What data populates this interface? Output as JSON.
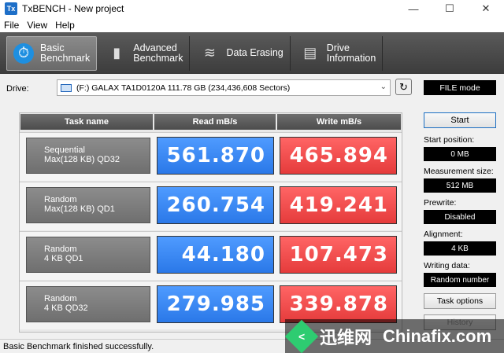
{
  "window": {
    "title": "TxBENCH - New project",
    "minimize": "—",
    "maximize": "☐",
    "close": "✕"
  },
  "menu": {
    "file": "File",
    "view": "View",
    "help": "Help"
  },
  "toolbar": {
    "basic": "Basic\nBenchmark",
    "advanced": "Advanced\nBenchmark",
    "erasing": "Data Erasing",
    "info": "Drive\nInformation"
  },
  "drive": {
    "label": "Drive:",
    "value": "(F:) GALAX TA1D0120A  111.78 GB (234,436,608 Sectors)",
    "mode": "FILE mode"
  },
  "table": {
    "headers": [
      "Task name",
      "Read mB/s",
      "Write mB/s"
    ],
    "rows": [
      {
        "task": "Sequential\nMax(128 KB) QD32",
        "read": "561.870",
        "write": "465.894"
      },
      {
        "task": "Random\nMax(128 KB) QD1",
        "read": "260.754",
        "write": "419.241"
      },
      {
        "task": "Random\n4 KB QD1",
        "read": "44.180",
        "write": "107.473"
      },
      {
        "task": "Random\n4 KB QD32",
        "read": "279.985",
        "write": "339.878"
      }
    ]
  },
  "side": {
    "start": "Start",
    "start_position_label": "Start position:",
    "start_position": "0 MB",
    "measurement_size_label": "Measurement size:",
    "measurement_size": "512 MB",
    "prewrite_label": "Prewrite:",
    "prewrite": "Disabled",
    "alignment_label": "Alignment:",
    "alignment": "4 KB",
    "writing_data_label": "Writing data:",
    "writing_data": "Random number",
    "task_options": "Task options",
    "history": "History"
  },
  "status": "Basic Benchmark finished successfully.",
  "watermark": {
    "cn": "迅维网",
    "en": "Chinafix.com"
  },
  "colors": {
    "read": "#2a78e8",
    "write": "#e53b3b",
    "toolbar": "#4a4a4a"
  }
}
